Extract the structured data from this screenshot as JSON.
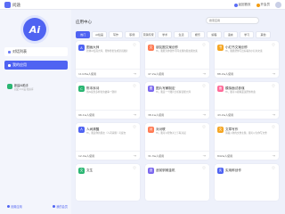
{
  "app": {
    "name": "问途"
  },
  "topbar": {
    "btn1": "返回首页",
    "btn2": "开会员"
  },
  "sidebar": {
    "items": [
      {
        "label": "对话列表"
      },
      {
        "label": "我的应用"
      }
    ],
    "sub": {
      "title": "新建AI助手",
      "subtitle": "自定义人设·知识库"
    },
    "bottom": {
      "left": "设置应用",
      "right": "我的会员"
    }
  },
  "main": {
    "title": "应用中心",
    "search_placeholder": "搜索应用",
    "tabs": [
      "热门",
      "AI绘画",
      "写作",
      "职场",
      "营销专家",
      "学术",
      "生活",
      "娱乐",
      "编程",
      "语言",
      "学习",
      "其他"
    ]
  },
  "cards": [
    {
      "title": "图画大师",
      "desc": "新体AI绘画大师，帮你轻松生成漂亮图片",
      "usage": "114.8w人使用",
      "color": "#4f63f2",
      "icon": "A"
    },
    {
      "title": "朋友圈文案创作",
      "desc": "Hi，我能为你创作不同主题的朋友圈文案",
      "usage": "47.2w人使用",
      "color": "#ff7b54",
      "icon": "文"
    },
    {
      "title": "小红书文案创作",
      "desc": "Hi，我能帮你写出好看的小红书文案",
      "usage": "88.2w人使用",
      "color": "#f5a623",
      "icon": "书"
    },
    {
      "title": "陈本序诗",
      "desc": "用AI提供多样化的故事一键排",
      "usage": "96.1w人使用",
      "color": "#2bb673",
      "icon": "C"
    },
    {
      "title": "图片写解制定",
      "desc": "Hi，我是一个图片分析解读能大师",
      "usage": "38.1w人使用",
      "color": "#7b68ee",
      "icon": "图"
    },
    {
      "title": "模拟面试参谋",
      "desc": "Hi，我可以模拟面试帮你准备",
      "usage": "43.2w人使用",
      "color": "#ff6b9a",
      "icon": "面"
    },
    {
      "title": "人间清醒",
      "desc": "Hi，我是你的朋友（人间清醒）可提交",
      "usage": "12.4w人使用",
      "color": "#4f63f2",
      "icon": "人"
    },
    {
      "title": "对对联",
      "desc": "Hi，我可以帮你对上下联对起",
      "usage": "31.3w人使用",
      "color": "#ff7b54",
      "icon": "对"
    },
    {
      "title": "文章写作",
      "desc": "请输入你的文章主题，我可以为你写文章",
      "usage": "842w人使用",
      "color": "#f5a623",
      "icon": "文"
    },
    {
      "title": "文生",
      "desc": "",
      "usage": "",
      "color": "#2bb673",
      "icon": "文"
    },
    {
      "title": "逐前驯械金机",
      "desc": "",
      "usage": "",
      "color": "#7b68ee",
      "icon": "逐"
    },
    {
      "title": "实用郎创作",
      "desc": "",
      "usage": "",
      "color": "#4f63f2",
      "icon": "实"
    }
  ]
}
